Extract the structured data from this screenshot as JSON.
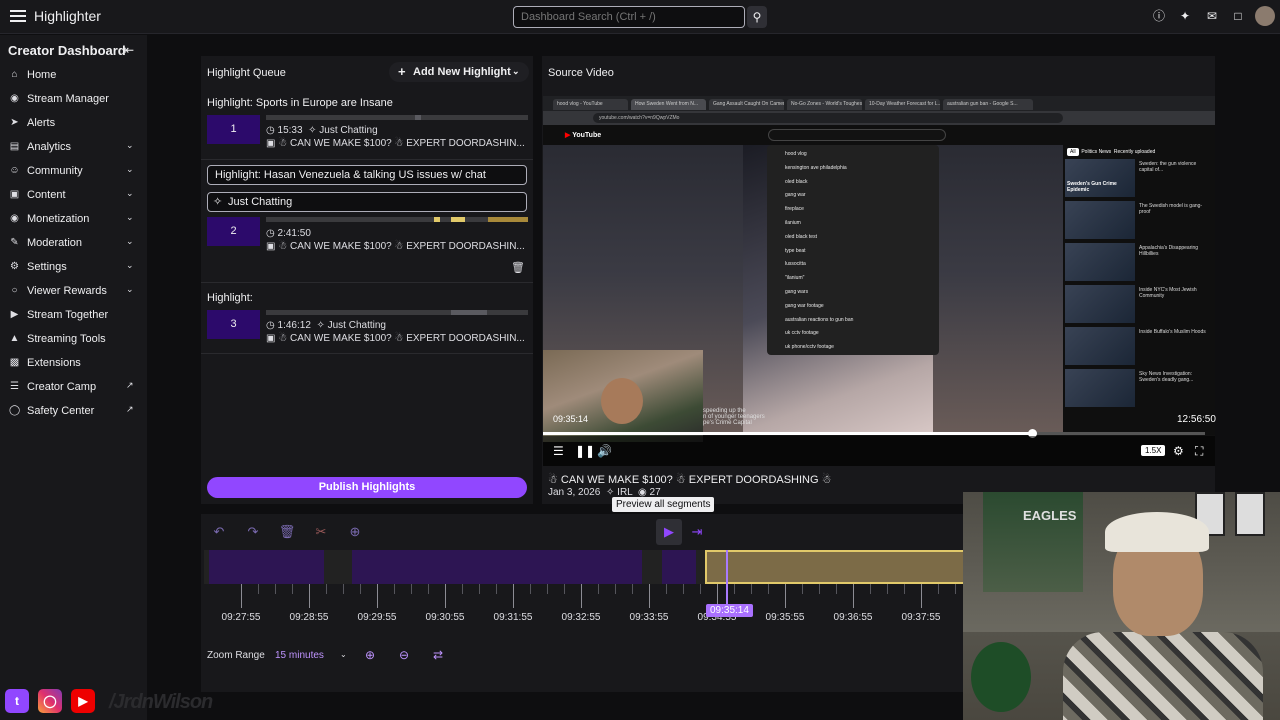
{
  "app": {
    "title": "Highlighter"
  },
  "search": {
    "placeholder": "Dashboard Search (Ctrl + /)"
  },
  "sidebar": {
    "heading": "Creator Dashboard",
    "items": [
      {
        "label": "Home",
        "icon": "home-icon"
      },
      {
        "label": "Stream Manager",
        "icon": "stream-manager-icon"
      },
      {
        "label": "Alerts",
        "icon": "alerts-icon"
      },
      {
        "label": "Analytics",
        "icon": "analytics-icon",
        "expandable": true
      },
      {
        "label": "Community",
        "icon": "community-icon",
        "expandable": true
      },
      {
        "label": "Content",
        "icon": "content-icon",
        "expandable": true
      },
      {
        "label": "Monetization",
        "icon": "monetization-icon",
        "expandable": true
      },
      {
        "label": "Moderation",
        "icon": "moderation-icon",
        "expandable": true
      },
      {
        "label": "Settings",
        "icon": "settings-icon",
        "expandable": true
      },
      {
        "label": "Viewer Rewards",
        "icon": "viewer-rewards-icon",
        "expandable": true
      },
      {
        "label": "Stream Together",
        "icon": "stream-together-icon"
      },
      {
        "label": "Streaming Tools",
        "icon": "streaming-tools-icon"
      },
      {
        "label": "Extensions",
        "icon": "extensions-icon"
      },
      {
        "label": "Creator Camp",
        "icon": "creator-camp-icon",
        "external": true
      },
      {
        "label": "Safety Center",
        "icon": "safety-center-icon",
        "external": true
      }
    ]
  },
  "queue": {
    "heading": "Highlight Queue",
    "add_label": "Add New Highlight",
    "publish_label": "Publish Highlights",
    "highlights": [
      {
        "title": "Highlight: Sports in Europe are Insane",
        "number": "1",
        "duration": "15:33",
        "category": "Just Chatting",
        "stream_title": "CAN WE MAKE $100? ☃ EXPERT DOORDASHIN..."
      },
      {
        "title_value": "Highlight: Hasan Venezuela & talking US issues w/ chat",
        "category_value": "Just Chatting",
        "number": "2",
        "duration": "2:41:50",
        "stream_title": "CAN WE MAKE $100? ☃ EXPERT DOORDASHIN..."
      },
      {
        "title": "Highlight:",
        "number": "3",
        "duration": "1:46:12",
        "category": "Just Chatting",
        "stream_title": "CAN WE MAKE $100? ☃ EXPERT DOORDASHIN..."
      }
    ]
  },
  "source": {
    "heading": "Source Video",
    "current_time": "09:35:14",
    "total_time": "12:56:50",
    "speed": "1.5X",
    "playback_progress": 0.74,
    "title": "CAN WE MAKE $100? ☃ EXPERT DOORDASHING",
    "date": "Jan 3, 2026",
    "category": "IRL",
    "views": "27",
    "caption_line1": "speeding up the",
    "caption_line2": "n of younger teenagers",
    "caption_line3": "pe's Crime Capital",
    "yt_suggestions": [
      "hood vlog",
      "kensington ave philadelphia",
      "oled black",
      "gang war",
      "fireplace",
      "ilanium",
      "oled black test",
      "type beat",
      "lussocitta",
      "\"ilanium\"",
      "gang wars",
      "gang war footage",
      "australian reactions to gun ban",
      "uk cctv footage",
      "uk phone/cctv footage"
    ],
    "yt_related": [
      "Sweden: the gun violence capital of...",
      "The Swedish model is gang-proof",
      "Appalachia's Disappearing Hillbillies",
      "Inside NYC's Most Jewish Community",
      "Inside Buffalo's Muslim Hoods",
      "Sky News Investigation: Sweden's deadly gang..."
    ],
    "thumb_label_1": "Sweden's Gun Crime Epidemic",
    "yt_url": "youtube.com/watch?v=n9QwpVZMo",
    "yt_chip_all": "All",
    "yt_chip_news": "Politics News",
    "yt_chip_recent": "Recently uploaded",
    "browser_tabs": [
      "hood vlog - YouTube",
      "How Sweden Went from N...",
      "Gang Assault Caught On Camer...",
      "No-Go Zones - World's Toughest...",
      "10-Day Weather Forecast for L...",
      "australian gun ban - Google S..."
    ]
  },
  "timeline": {
    "tooltip": "Preview all segments",
    "cursor_label": "09:35:14",
    "ticks": [
      "09:27:55",
      "09:28:55",
      "09:29:55",
      "09:30:55",
      "09:31:55",
      "09:32:55",
      "09:33:55",
      "09:34:55",
      "09:35:55",
      "09:36:55",
      "09:37:55"
    ],
    "zoom_label": "Zoom Range",
    "zoom_value": "15 minutes"
  },
  "webcam": {
    "poster_text": "EAGLES"
  },
  "social": {
    "handle": "/JrdnWilson"
  },
  "colors": {
    "accent": "#9147ff",
    "selected_segment": "#e1c96a",
    "segment": "#2d1553"
  }
}
